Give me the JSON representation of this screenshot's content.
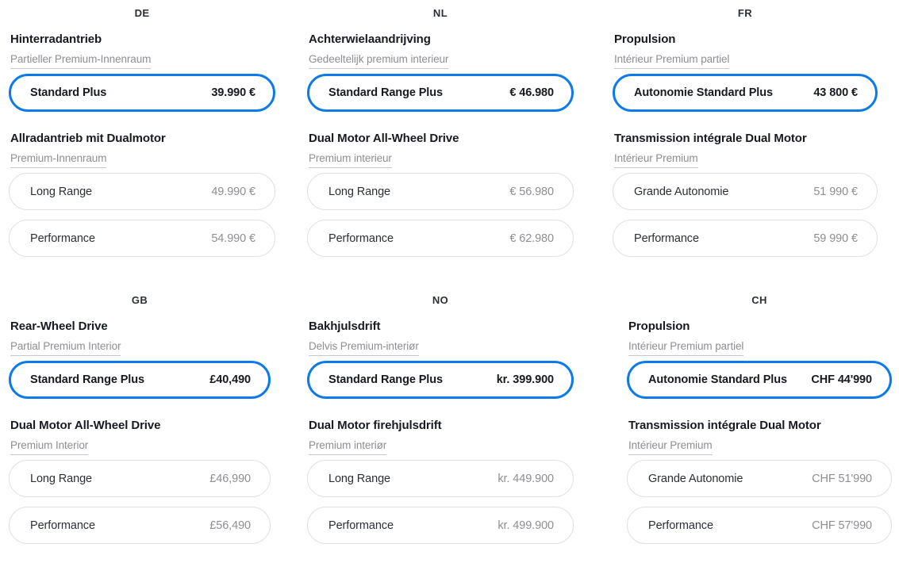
{
  "theme": {
    "accent": "#0c7ae8",
    "card_border": "#dfe0e3",
    "muted_text": "#8e8e93",
    "primary_text": "#171a20"
  },
  "panels": [
    {
      "id": "de",
      "country": "DE",
      "groups": [
        {
          "drive": "Hinterradantrieb",
          "interior": "Partieller Premium-Innenraum",
          "trims": [
            {
              "name": "Standard Plus",
              "price": "39.990 €",
              "selected": true
            }
          ]
        },
        {
          "drive": "Allradantrieb mit Dualmotor",
          "interior": "Premium-Innenraum",
          "trims": [
            {
              "name": "Long Range",
              "price": "49.990 €",
              "selected": false
            },
            {
              "name": "Performance",
              "price": "54.990 €",
              "selected": false
            }
          ]
        }
      ]
    },
    {
      "id": "nl",
      "country": "NL",
      "groups": [
        {
          "drive": "Achterwielaandrijving",
          "interior": "Gedeeltelijk premium interieur",
          "trims": [
            {
              "name": "Standard Range Plus",
              "price": "€ 46.980",
              "selected": true
            }
          ]
        },
        {
          "drive": "Dual Motor All-Wheel Drive",
          "interior": "Premium interieur",
          "trims": [
            {
              "name": "Long Range",
              "price": "€ 56.980",
              "selected": false
            },
            {
              "name": "Performance",
              "price": "€ 62.980",
              "selected": false
            }
          ]
        }
      ]
    },
    {
      "id": "fr",
      "country": "FR",
      "groups": [
        {
          "drive": "Propulsion",
          "interior": "Intérieur Premium partiel",
          "trims": [
            {
              "name": "Autonomie Standard Plus",
              "price": "43 800 €",
              "selected": true
            }
          ]
        },
        {
          "drive": "Transmission intégrale Dual Motor",
          "interior": "Intérieur Premium",
          "trims": [
            {
              "name": "Grande Autonomie",
              "price": "51 990 €",
              "selected": false
            },
            {
              "name": "Performance",
              "price": "59 990 €",
              "selected": false
            }
          ]
        }
      ]
    },
    {
      "id": "gb",
      "country": "GB",
      "groups": [
        {
          "drive": "Rear-Wheel Drive",
          "interior": "Partial Premium Interior",
          "trims": [
            {
              "name": "Standard Range Plus",
              "price": "£40,490",
              "selected": true
            }
          ]
        },
        {
          "drive": "Dual Motor All-Wheel Drive",
          "interior": "Premium Interior",
          "trims": [
            {
              "name": "Long Range",
              "price": "£46,990",
              "selected": false
            },
            {
              "name": "Performance",
              "price": "£56,490",
              "selected": false
            }
          ]
        }
      ]
    },
    {
      "id": "no",
      "country": "NO",
      "groups": [
        {
          "drive": "Bakhjulsdrift",
          "interior": "Delvis Premium-interiør",
          "trims": [
            {
              "name": "Standard Range Plus",
              "price": "kr. 399.900",
              "selected": true
            }
          ]
        },
        {
          "drive": "Dual Motor firehjulsdrift",
          "interior": "Premium interiør",
          "trims": [
            {
              "name": "Long Range",
              "price": "kr. 449.900",
              "selected": false
            },
            {
              "name": "Performance",
              "price": "kr. 499.900",
              "selected": false
            }
          ]
        }
      ]
    },
    {
      "id": "ch",
      "country": "CH",
      "groups": [
        {
          "drive": "Propulsion",
          "interior": "Intérieur Premium partiel",
          "trims": [
            {
              "name": "Autonomie Standard Plus",
              "price": "CHF 44'990",
              "selected": true
            }
          ]
        },
        {
          "drive": "Transmission intégrale Dual Motor",
          "interior": "Intérieur Premium",
          "trims": [
            {
              "name": "Grande Autonomie",
              "price": "CHF 51'990",
              "selected": false
            },
            {
              "name": "Performance",
              "price": "CHF 57'990",
              "selected": false
            }
          ]
        }
      ]
    }
  ]
}
